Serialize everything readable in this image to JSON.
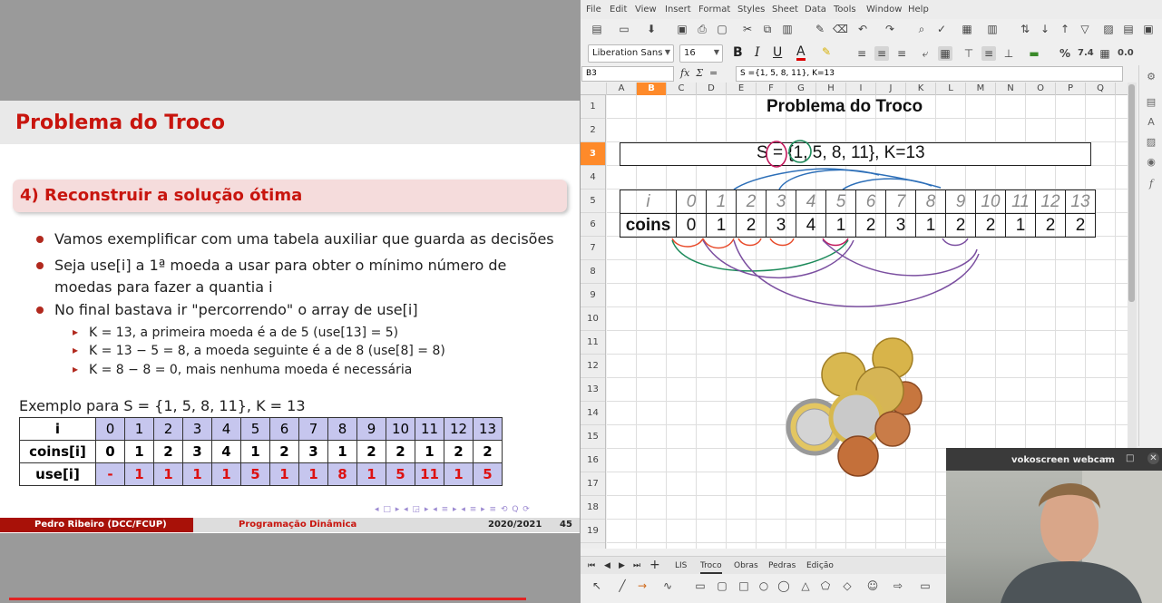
{
  "slide": {
    "title": "Problema do Troco",
    "section": "4) Reconstruir a solução ótima",
    "bullets": [
      "Vamos exemplificar com uma tabela auxiliar que guarda as decisões",
      "Seja use[i] a 1ª moeda a usar para obter o mínimo número de moedas para fazer a quantia i",
      "No final bastava ir \"percorrendo\" o array de use[i]"
    ],
    "bullet2_line1": "Seja use[i] a 1ª moeda a usar para obter o mínimo número de",
    "bullet2_line2": "moedas para fazer a quantia i",
    "subbullets": [
      "K = 13, a primeira moeda é a de 5 (use[13] = 5)",
      "K = 13 − 5 = 8, a moeda seguinte é a de 8 (use[8] = 8)",
      "K = 8 − 8 = 0, mais nenhuma moeda é necessária"
    ],
    "example_label": "Exemplo para S = {1, 5, 8, 11}, K = 13",
    "table": {
      "row_labels": [
        "i",
        "coins[i]",
        "use[i]"
      ],
      "i": [
        "0",
        "1",
        "2",
        "3",
        "4",
        "5",
        "6",
        "7",
        "8",
        "9",
        "10",
        "11",
        "12",
        "13"
      ],
      "coins": [
        "0",
        "1",
        "2",
        "3",
        "4",
        "1",
        "2",
        "3",
        "1",
        "2",
        "2",
        "1",
        "2",
        "2"
      ],
      "use": [
        "-",
        "1",
        "1",
        "1",
        "1",
        "5",
        "1",
        "1",
        "8",
        "1",
        "5",
        "11",
        "1",
        "5"
      ]
    },
    "nav_symbols": "◂ □ ▸ ◂ ◲ ▸ ◂ ≡ ▸ ◂ ≡ ▸  ≡  ⟲ Q ⟳",
    "footer": {
      "author": "Pedro Ribeiro (DCC/FCUP)",
      "topic": "Programação Dinâmica",
      "year": "2020/2021",
      "page": "45"
    }
  },
  "app": {
    "menu": [
      "File",
      "Edit",
      "View",
      "Insert",
      "Format",
      "Styles",
      "Sheet",
      "Data",
      "Tools",
      "Window",
      "Help"
    ],
    "font_name": "Liberation Sans",
    "font_size": "16",
    "cell_ref": "B3",
    "formula": "S ={1, 5, 8, 11}, K=13",
    "columns": [
      "A",
      "B",
      "C",
      "D",
      "E",
      "F",
      "G",
      "H",
      "I",
      "J",
      "K",
      "L",
      "M",
      "N",
      "O",
      "P",
      "Q"
    ],
    "rows": [
      "1",
      "2",
      "3",
      "4",
      "5",
      "6",
      "7",
      "8",
      "9",
      "10",
      "11",
      "12",
      "13",
      "14",
      "15",
      "16",
      "17",
      "18",
      "19"
    ],
    "sheet_title": "Problema do Troco",
    "set_text": "S = {1, 5, 8, 11},  K=13",
    "table": {
      "i_label": "i",
      "coins_label": "coins",
      "i": [
        "0",
        "1",
        "2",
        "3",
        "4",
        "5",
        "6",
        "7",
        "8",
        "9",
        "10",
        "11",
        "12",
        "13"
      ],
      "coins": [
        "0",
        "1",
        "2",
        "3",
        "4",
        "1",
        "2",
        "3",
        "1",
        "2",
        "2",
        "1",
        "2",
        "2"
      ]
    },
    "tabs": [
      "LIS",
      "Troco",
      "Obras",
      "Pedras",
      "Edição"
    ],
    "active_tab": "Troco"
  },
  "webcam": {
    "title": "vokoscreen webcam"
  },
  "colors": {
    "slide_red": "#c8150e",
    "selection_orange": "#fe8a2a",
    "table_blue": "#c6c6ee"
  }
}
